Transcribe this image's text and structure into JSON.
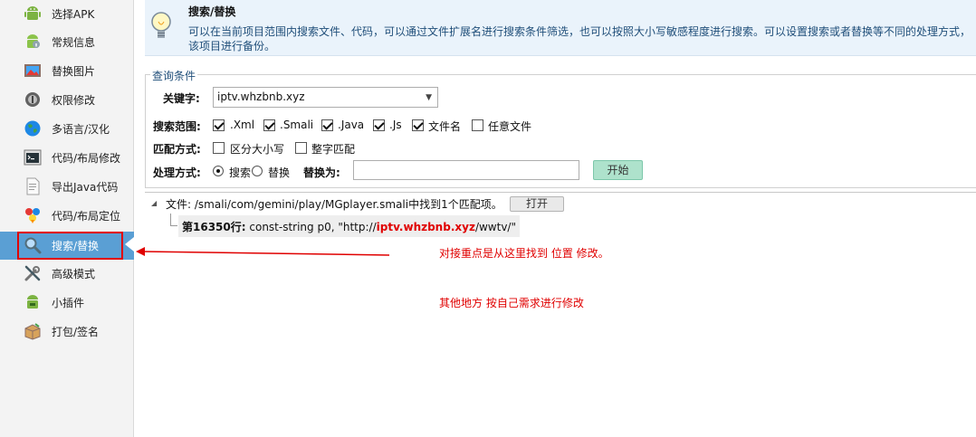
{
  "sidebar": {
    "items": [
      {
        "label": "选择APK",
        "icon": "android-icon"
      },
      {
        "label": "常规信息",
        "icon": "android-info-icon"
      },
      {
        "label": "替换图片",
        "icon": "image-icon"
      },
      {
        "label": "权限修改",
        "icon": "permission-icon"
      },
      {
        "label": "多语言/汉化",
        "icon": "globe-icon"
      },
      {
        "label": "代码/布局修改",
        "icon": "code-window-icon"
      },
      {
        "label": "导出Java代码",
        "icon": "java-document-icon"
      },
      {
        "label": "代码/布局定位",
        "icon": "locate-icon"
      },
      {
        "label": "搜索/替换",
        "icon": "magnifier-icon",
        "active": true
      },
      {
        "label": "高级模式",
        "icon": "tools-icon"
      },
      {
        "label": "小插件",
        "icon": "android-plugin-icon"
      },
      {
        "label": "打包/签名",
        "icon": "package-icon"
      }
    ],
    "active_color": "#5a9fd4"
  },
  "header": {
    "title": "搜索/替换",
    "description": "可以在当前项目范围内搜索文件、代码，可以通过文件扩展名进行搜索条件筛选，也可以按照大小写敏感程度进行搜索。可以设置搜索或者替换等不同的处理方式，该项目进行备份。",
    "icon": "lightbulb-icon"
  },
  "query": {
    "legend": "查询条件",
    "keyword_label": "关键字:",
    "keyword_value": "iptv.whzbnb.xyz",
    "scope_label": "搜索范围:",
    "scope_options": [
      {
        "label": ".Xml",
        "checked": true
      },
      {
        "label": ".Smali",
        "checked": true
      },
      {
        "label": ".Java",
        "checked": true
      },
      {
        "label": ".Js",
        "checked": true
      },
      {
        "label": "文件名",
        "checked": true
      },
      {
        "label": "任意文件",
        "checked": false
      }
    ],
    "match_label": "匹配方式:",
    "match_options": [
      {
        "label": "区分大小写",
        "checked": false
      },
      {
        "label": "整字匹配",
        "checked": false
      }
    ],
    "process_label": "处理方式:",
    "process_options": [
      {
        "label": "搜索",
        "selected": true
      },
      {
        "label": "替换",
        "selected": false
      }
    ],
    "replace_label": "替换为:",
    "replace_value": "",
    "start_button": "开始",
    "start_button_color": "#aee2cc"
  },
  "results": {
    "file_line": "文件: /smali/com/gemini/play/MGplayer.smali中找到1个匹配项。",
    "open_button": "打开",
    "match": {
      "line_no": "第16350行:",
      "prefix": " const-string p0, \"http://",
      "highlight": "iptv.whzbnb.xyz",
      "suffix": "/wwtv/\""
    }
  },
  "annotations": {
    "note1": "对接重点是从这里找到 位置 修改。",
    "note2": "其他地方 按自己需求进行修改",
    "color": "#e00000"
  }
}
